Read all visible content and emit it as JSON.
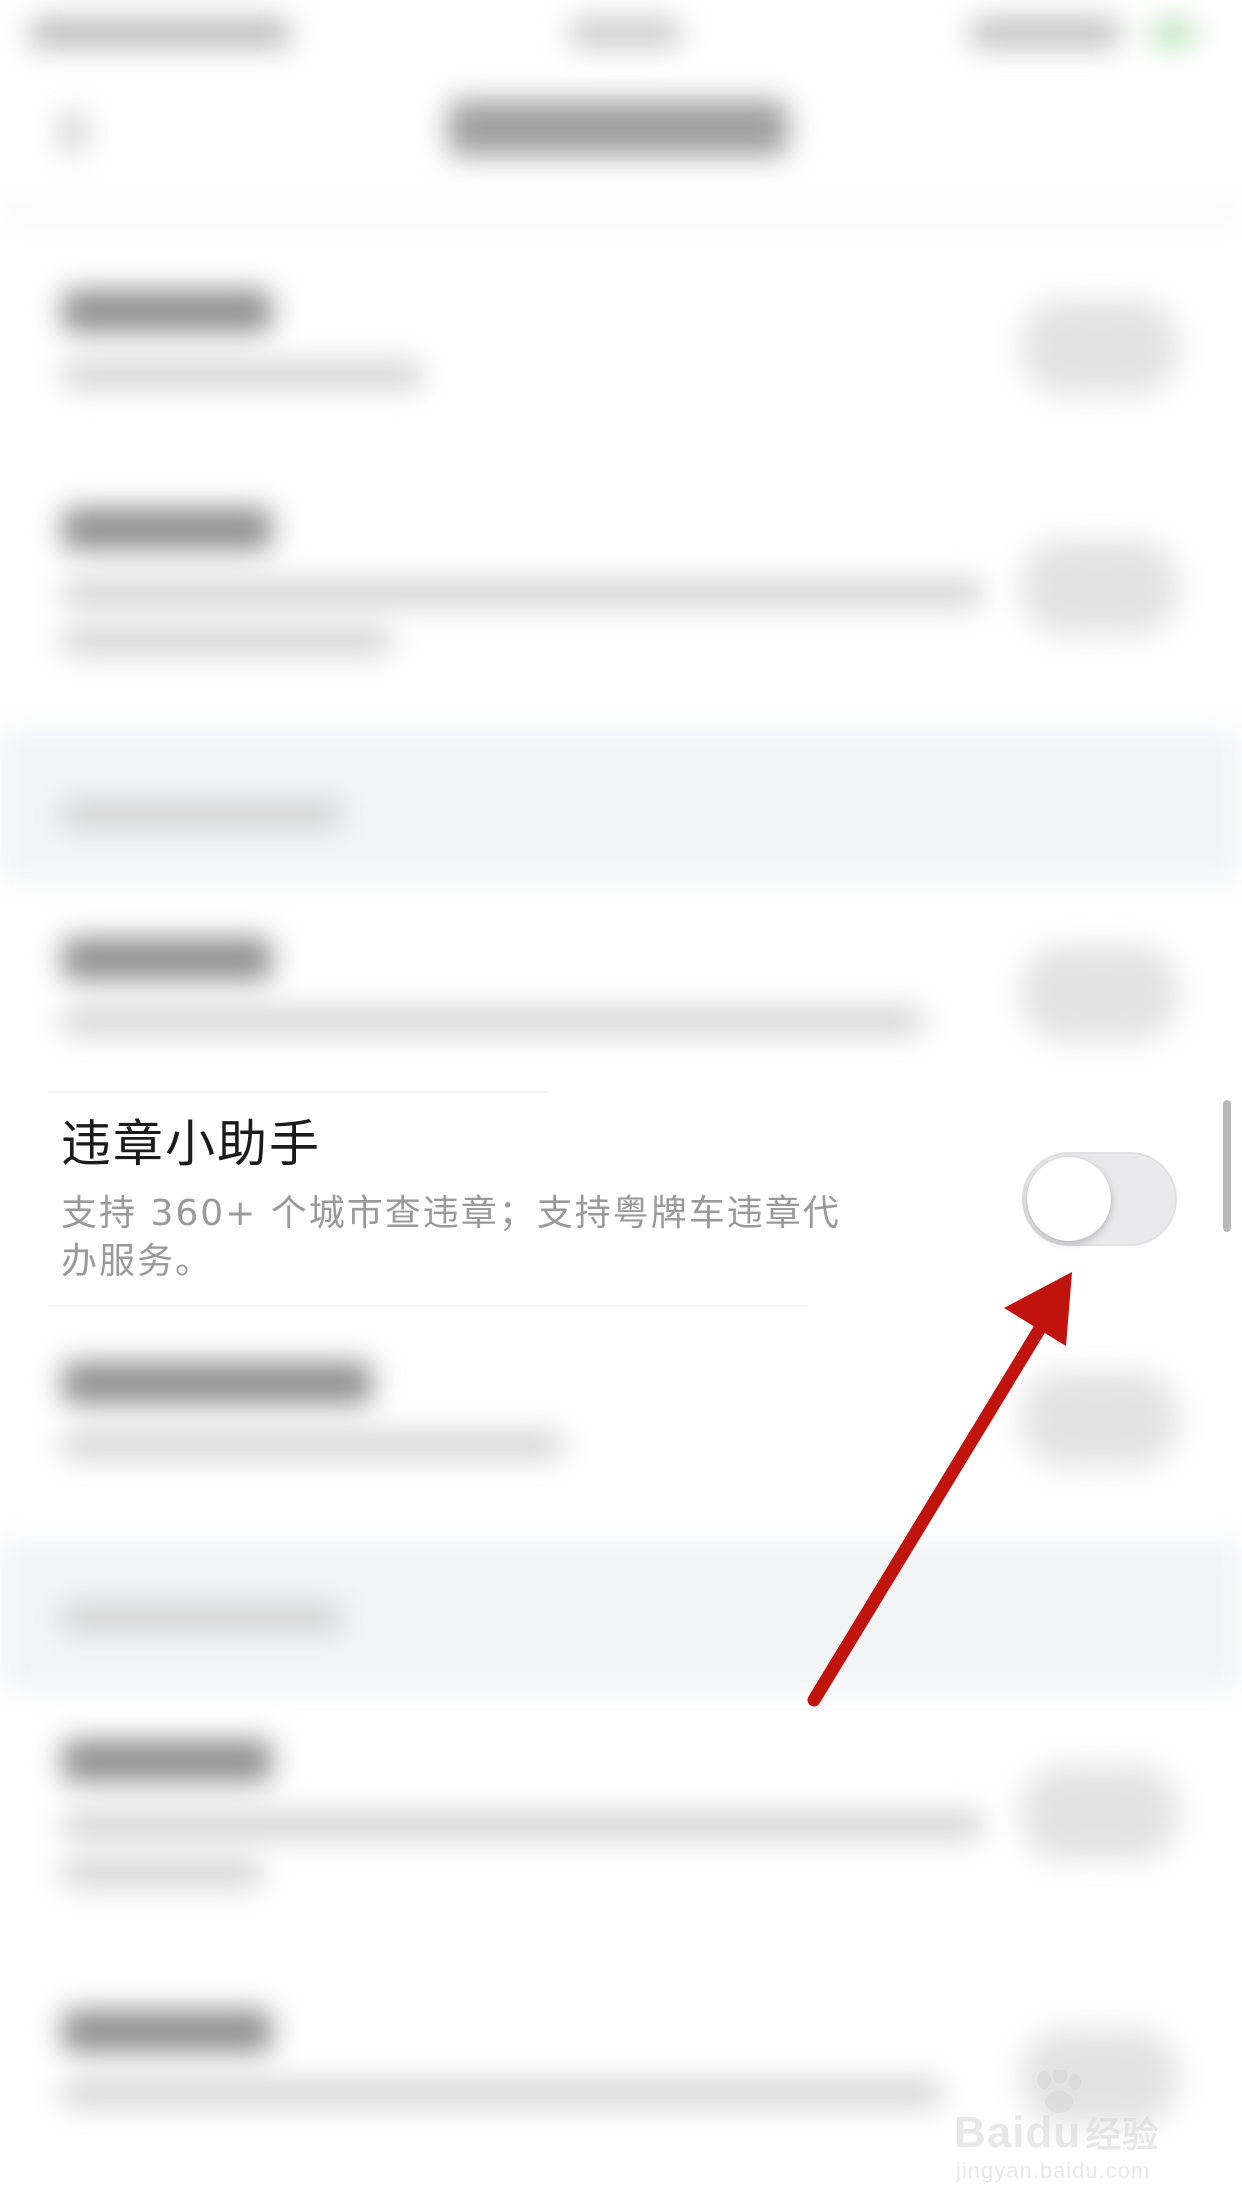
{
  "setting_item": {
    "title": "违章小助手",
    "description": "支持 360+ 个城市查违章；支持粤牌车违章代办服务。",
    "toggle_on": false
  },
  "colors": {
    "title": "#1b1b1b",
    "description": "#9a9a9a",
    "toggle_track_off": "#e9e9eb",
    "toggle_knob": "#ffffff",
    "arrow": "#c0130c",
    "band": "#f3f4f6"
  },
  "watermark": {
    "brand": "Baidu",
    "brand_sub": "经验",
    "url": "jingyan.baidu.com"
  },
  "icons": {
    "pointer": "arrow-annotation-icon",
    "watermark": "baidu-paw-icon"
  }
}
